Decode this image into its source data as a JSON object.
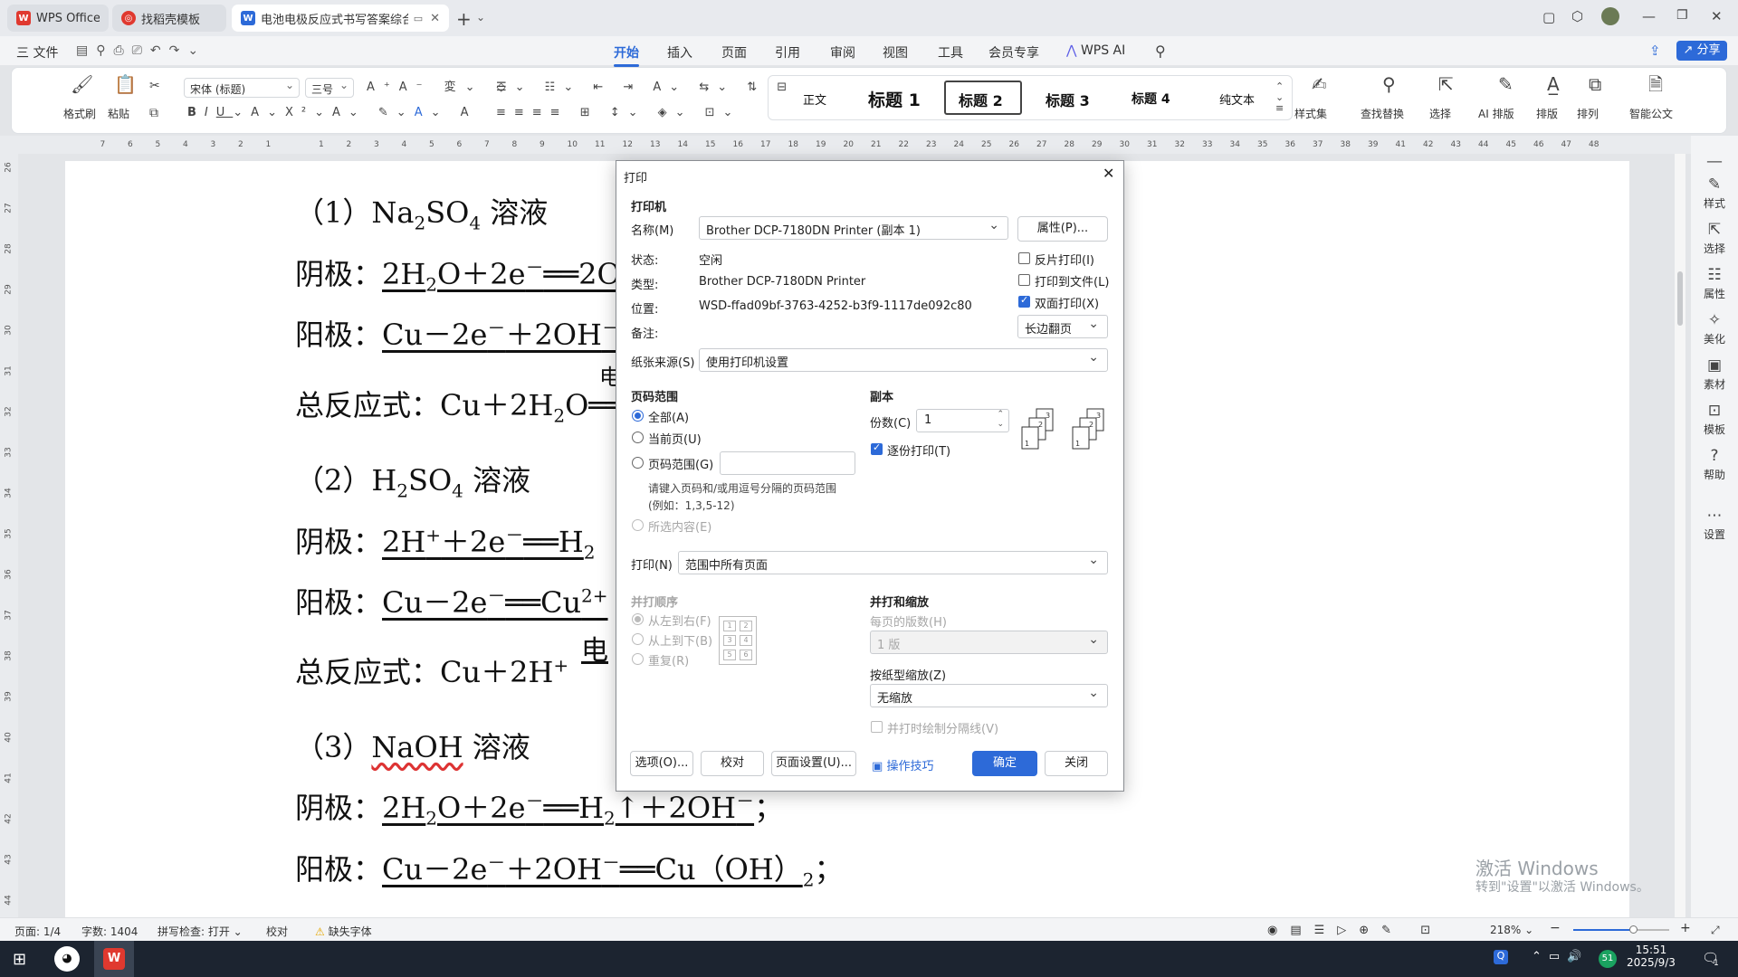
{
  "titlebar": {
    "tabs": [
      {
        "label": "WPS Office",
        "icon": "wps-logo-icon"
      },
      {
        "label": "找稻壳模板",
        "icon": "docer-icon"
      },
      {
        "label": "电池电极反应式书写答案综合",
        "icon": "wps-writer-icon"
      }
    ],
    "add_tab": "+",
    "colors": {
      "wps_red": "#e0392f",
      "accent": "#2d6ad8"
    }
  },
  "menubar": {
    "file": "三 文件",
    "tabs": [
      "开始",
      "插入",
      "页面",
      "引用",
      "审阅",
      "视图",
      "工具",
      "会员专享",
      "WPS AI"
    ],
    "active_tab": "开始",
    "share": "分享"
  },
  "ribbon": {
    "format_painter": "格式刷",
    "paste": "粘贴",
    "font_name": "宋体 (标题)",
    "font_size": "三号",
    "styles": [
      "正文",
      "标题 1",
      "标题 2",
      "标题 3",
      "标题 4",
      "纯文本"
    ],
    "style_set": "样式集",
    "find_replace": "查找替换",
    "select": "选择",
    "ai_layout": "AI 排版",
    "layout": "排版",
    "arrange": "排列",
    "smart_doc": "智能公文"
  },
  "ruler": {
    "left_ticks": [
      "7",
      "6",
      "5",
      "4",
      "3",
      "2",
      "1"
    ],
    "right_ticks": [
      "1",
      "2",
      "3",
      "4",
      "5",
      "6",
      "7",
      "8",
      "9",
      "10",
      "11",
      "12",
      "13",
      "14",
      "15",
      "16",
      "17",
      "18",
      "19",
      "20",
      "21",
      "22",
      "23",
      "24",
      "25",
      "26",
      "27",
      "28",
      "29",
      "30",
      "31",
      "32",
      "33",
      "34",
      "35",
      "36",
      "37",
      "38",
      "39",
      "41",
      "42",
      "43",
      "44",
      "45",
      "46",
      "47",
      "48"
    ],
    "vertical_ticks": [
      "26",
      "27",
      "28",
      "29",
      "30",
      "31",
      "32",
      "33",
      "34",
      "35",
      "36",
      "37",
      "38",
      "39",
      "40",
      "41",
      "42",
      "43",
      "44"
    ]
  },
  "document": {
    "h1": "（1）Na",
    "h1_sub": "2",
    "h1_b": "SO",
    "h1_sub2": "4",
    "h1_c": " 溶液",
    "l1_label": "阴极：",
    "l1_text": "2H",
    "l1_sub": "2",
    "l1_b": "O＋2e",
    "l1_sup": "－",
    "l1_c": "══2O",
    "l2_label": "阳极：",
    "l2_text": "Cu－2e",
    "l2_sup": "－",
    "l2_b": "＋2OH",
    "l2_sup2": "－",
    "l3_text": "总反应式：Cu＋2H",
    "l3_sub": "2",
    "l3_b": "O══",
    "l3_over": "电",
    "h2": "（2）H",
    "h2_sub": "2",
    "h2_b": "SO",
    "h2_sub2": "4",
    "h2_c": " 溶液",
    "l4_label": "阴极：",
    "l4_text": "2H",
    "l4_sup": "+",
    "l4_b": "＋2e",
    "l4_sup2": "－",
    "l4_c": "══H",
    "l4_sub": "2",
    "l5_label": "阳极：",
    "l5_text": "Cu－2e",
    "l5_sup": "－",
    "l5_b": "══Cu",
    "l5_sup2": "2+",
    "l6_text": "总反应式：Cu＋2H",
    "l6_sup": "+",
    "l6_over": "电",
    "h3": "（3）",
    "h3_b": "NaOH",
    "h3_c": " 溶液",
    "l7_label": "阴极：",
    "l7_text": "2H",
    "l7_sub": "2",
    "l7_b": "O＋2e",
    "l7_sup": "－",
    "l7_c": "══H",
    "l7_sub2": "2",
    "l7_d": "↑＋2OH",
    "l7_sup2": "－",
    "l7_e": "；",
    "l8_label": "阳极：",
    "l8_text": "Cu－2e",
    "l8_sup": "－",
    "l8_b": "＋2OH",
    "l8_sup2": "－",
    "l8_c": "══Cu（OH）",
    "l8_sub": "2",
    "l8_d": "；"
  },
  "dialog": {
    "title": "打印",
    "printer_section": "打印机",
    "name_label": "名称(M)",
    "printer_name": "Brother DCP-7180DN Printer (副本 1)",
    "properties_btn": "属性(P)...",
    "status_label": "状态:",
    "status_value": "空闲",
    "type_label": "类型:",
    "type_value": "Brother DCP-7180DN Printer",
    "location_label": "位置:",
    "location_value": "WSD-ffad09bf-3763-4252-b3f9-1117de092c80",
    "comment_label": "备注:",
    "reverse_print": "反片打印(I)",
    "print_to_file": "打印到文件(L)",
    "duplex": "双面打印(X)",
    "duplex_mode": "长边翻页",
    "paper_source_label": "纸张来源(S)",
    "paper_source": "使用打印机设置",
    "page_range_section": "页码范围",
    "all": "全部(A)",
    "current_page": "当前页(U)",
    "page_range": "页码范围(G)",
    "range_hint_1": "请键入页码和/或用逗号分隔的页码范围",
    "range_hint_2": "(例如：1,3,5-12)",
    "selection": "所选内容(E)",
    "copies_section": "副本",
    "copies_label": "份数(C)",
    "copies_value": "1",
    "collate": "逐份打印(T)",
    "print_label": "打印(N)",
    "print_value": "范围中所有页面",
    "order_section": "并打顺序",
    "left_to_right": "从左到右(F)",
    "top_to_bottom": "从上到下(B)",
    "repeat": "重复(R)",
    "order_grid": [
      "1",
      "2",
      "3",
      "4",
      "5",
      "6"
    ],
    "zoom_section": "并打和缩放",
    "pages_per_sheet_label": "每页的版数(H)",
    "pages_per_sheet": "1 版",
    "scale_label": "按纸型缩放(Z)",
    "scale_value": "无缩放",
    "draw_lines": "并打时绘制分隔线(V)",
    "options_btn": "选项(O)...",
    "proof_btn": "校对",
    "page_setup_btn": "页面设置(U)...",
    "tips_link": "操作技巧",
    "ok_btn": "确定",
    "close_btn": "关闭"
  },
  "right_panel": [
    "样式",
    "选择",
    "属性",
    "美化",
    "素材",
    "模板",
    "帮助",
    "设置"
  ],
  "statusbar": {
    "page": "页面: 1/4",
    "words": "字数: 1404",
    "spell": "拼写检查: 打开",
    "proof": "校对",
    "missing_font": "缺失字体",
    "zoom": "218%"
  },
  "watermark": {
    "line1": "激活 Windows",
    "line2": "转到\"设置\"以激活 Windows。"
  },
  "taskbar": {
    "time": "15:51",
    "date": "2025/9/3",
    "badge": "51",
    "notif": "1"
  }
}
